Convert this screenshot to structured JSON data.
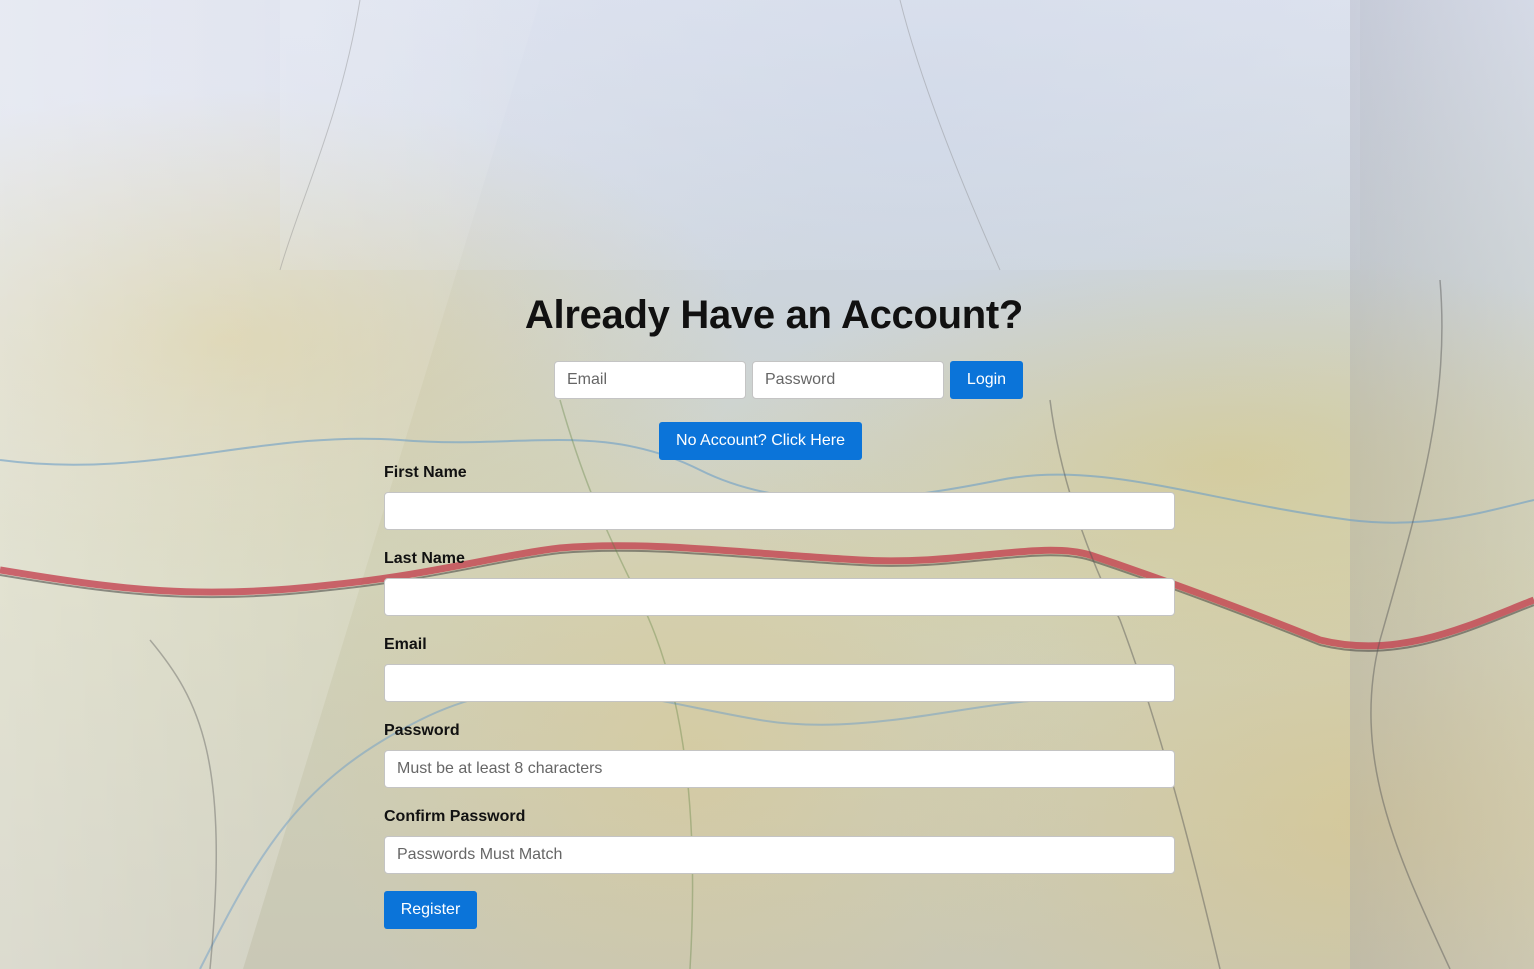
{
  "colors": {
    "accent": "#0b74d9",
    "title_text": "#111111"
  },
  "header": {
    "title": "Already Have an Account?"
  },
  "login": {
    "email_placeholder": "Email",
    "password_placeholder": "Password",
    "login_label": "Login"
  },
  "signup_toggle": {
    "label": "No Account? Click Here"
  },
  "register": {
    "fields": [
      {
        "label": "First Name",
        "placeholder": ""
      },
      {
        "label": "Last Name",
        "placeholder": ""
      },
      {
        "label": "Email",
        "placeholder": ""
      },
      {
        "label": "Password",
        "placeholder": "Must be at least 8 characters"
      },
      {
        "label": "Confirm Password",
        "placeholder": "Passwords Must Match"
      }
    ],
    "submit_label": "Register"
  }
}
